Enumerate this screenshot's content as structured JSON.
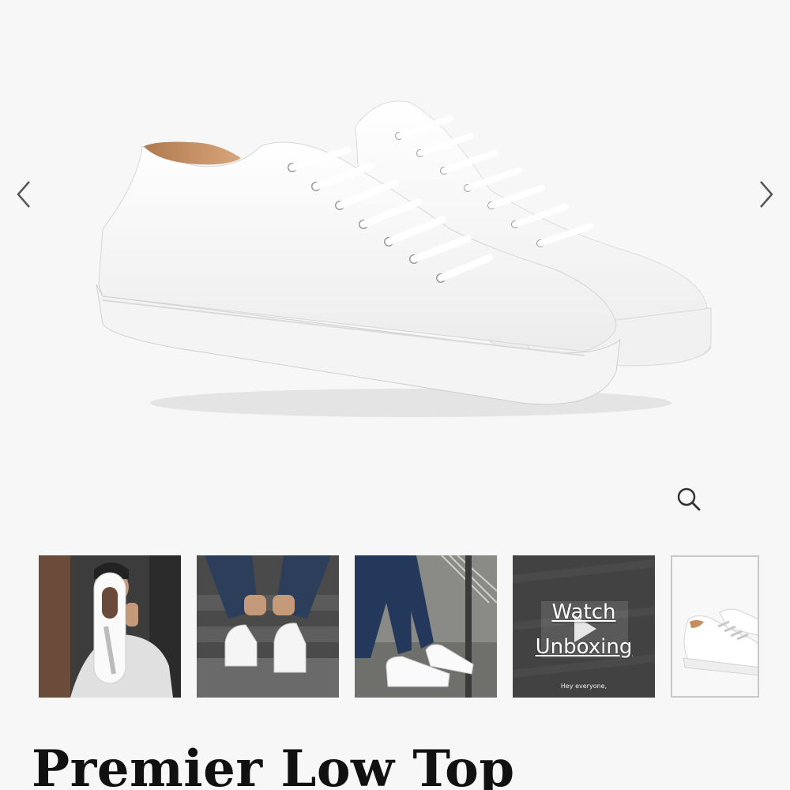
{
  "gallery": {
    "main_image_alt": "White leather low top sneakers",
    "prev_icon": "chevron-left-icon",
    "next_icon": "chevron-right-icon",
    "zoom_icon": "magnifier-icon"
  },
  "thumbnails": [
    {
      "name": "thumb-hand-holding-sneaker"
    },
    {
      "name": "thumb-lacing-sneakers"
    },
    {
      "name": "thumb-sneakers-on-steps"
    },
    {
      "name": "thumb-watch-unboxing",
      "label_line1": "Watch",
      "label_line2": "Unboxing",
      "caption": "Hey everyone,"
    },
    {
      "name": "thumb-sneaker-pair",
      "active": true
    }
  ],
  "product": {
    "title": "Premier Low Top"
  },
  "colors": {
    "background": "#f7f7f7",
    "title": "#111111",
    "active_thumb_border": "#c8c8c8"
  }
}
